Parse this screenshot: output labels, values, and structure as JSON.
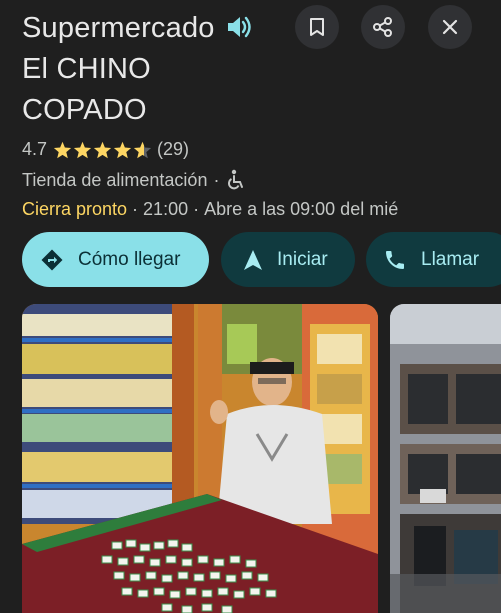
{
  "place": {
    "title": "Supermercado El CHINO COPADO",
    "rating": "4.7",
    "star_count": 4.7,
    "reviews": "(29)",
    "category": "Tienda de alimentación",
    "accessibility_icon": "wheelchair-icon",
    "status": "Cierra pronto",
    "closing_time": "21:00",
    "next_open": "Abre a las 09:00 del mié"
  },
  "header": {
    "speaker_icon": "speaker-icon",
    "bookmark_icon": "bookmark-icon",
    "share_icon": "share-icon",
    "close_icon": "close-icon"
  },
  "actions": {
    "directions_label": "Cómo llegar",
    "start_label": "Iniciar",
    "call_label": "Llamar"
  },
  "colors": {
    "background": "#1f1f1f",
    "star": "#fdd663",
    "status": "#fdd663",
    "primary_button": "#8ae0e8",
    "secondary_button": "#103a3f"
  }
}
